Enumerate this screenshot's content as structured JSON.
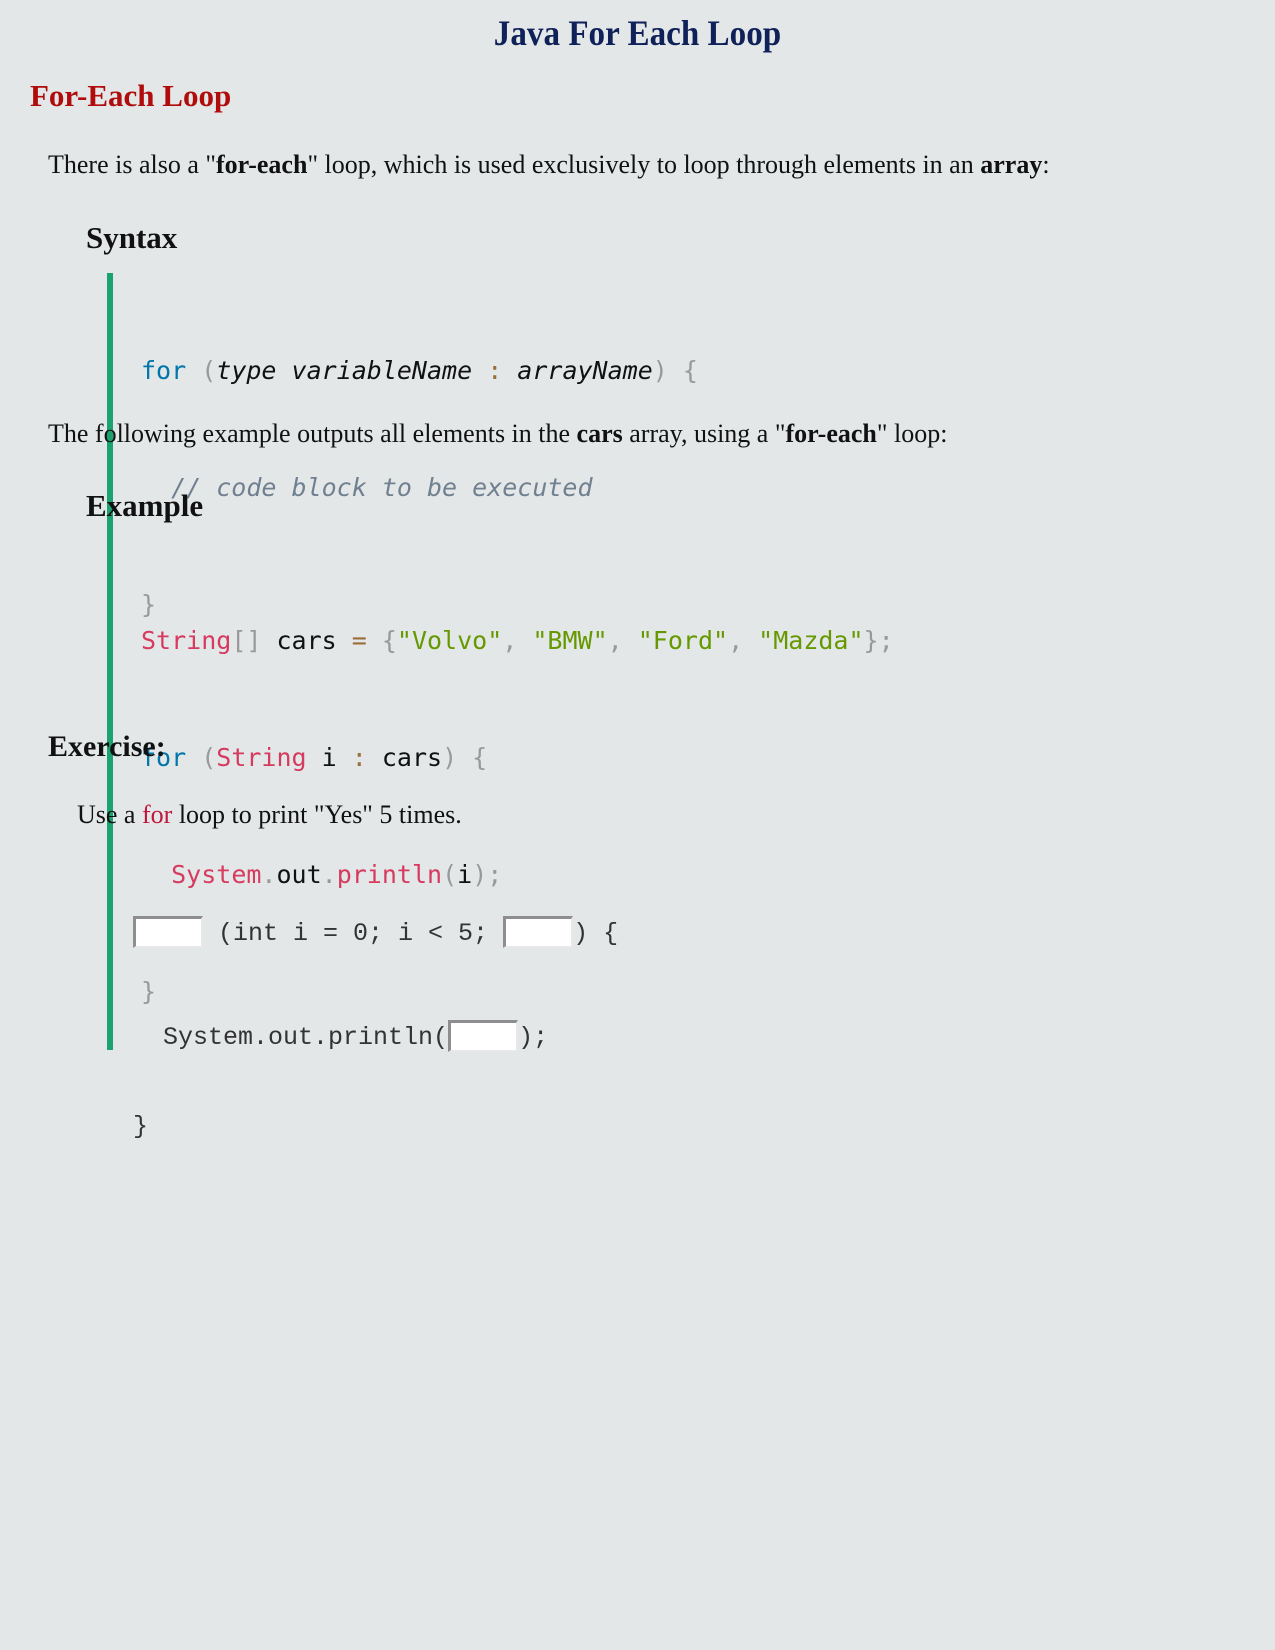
{
  "page_title": "Java For Each Loop",
  "section_title": "For-Each Loop",
  "intro": {
    "pre": "There is also a \"",
    "bold1": "for-each",
    "mid": "\" loop, which is used exclusively to loop through elements in an ",
    "bold2": "array",
    "post": ":"
  },
  "syntax": {
    "heading": "Syntax",
    "lines": [
      {
        "kw": "for",
        "open": " (",
        "type": "type variableName",
        "colon": " : ",
        "arr": "arrayName",
        "close": ") {"
      },
      {
        "comment": "  // code block to be executed"
      },
      {
        "brace": "}"
      }
    ]
  },
  "example_intro": {
    "pre": "The following example outputs all elements in the ",
    "bold1": "cars",
    "mid": " array, using a \"",
    "bold2": "for-each",
    "post": "\" loop:"
  },
  "example": {
    "heading": "Example",
    "line1": {
      "type": "String",
      "brackets": "[]",
      "var": " cars ",
      "eq": "=",
      "open": " {",
      "values": [
        "\"Volvo\"",
        "\"BMW\"",
        "\"Ford\"",
        "\"Mazda\""
      ],
      "sep": ", ",
      "close": "};"
    },
    "line2": {
      "kw": "for",
      "open": " (",
      "type": "String",
      "var": " i ",
      "colon": ":",
      "arr": " cars",
      "close": ") {"
    },
    "line3": {
      "indent": "  ",
      "cls": "System",
      "dot1": ".",
      "field": "out",
      "dot2": ".",
      "method": "println",
      "open": "(",
      "arg": "i",
      "close": ");"
    },
    "line4": "}"
  },
  "exercise": {
    "heading": "Exercise:",
    "prompt_pre": "Use a ",
    "prompt_kw": "for",
    "prompt_post": " loop to print \"Yes\" 5 times.",
    "line1_mid": " (int i = 0; i < 5; ",
    "line1_end": ") {",
    "line2_pre": "  System.out.println(",
    "line2_end": ");",
    "line3": "}",
    "blanks": [
      "",
      "",
      ""
    ]
  },
  "colors": {
    "title": "#0f2158",
    "section": "#b00c0c",
    "code_border": "#1aa36e",
    "keyword": "#0077aa",
    "type": "#d63a5f",
    "string": "#669900"
  }
}
